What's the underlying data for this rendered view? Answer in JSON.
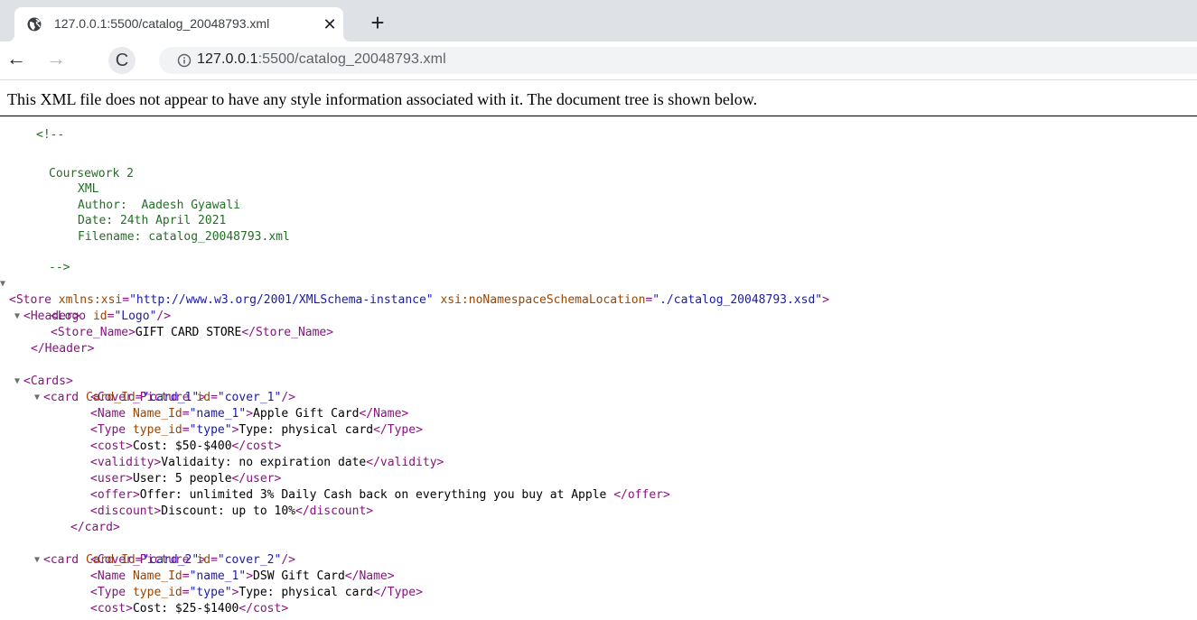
{
  "browser": {
    "tab": {
      "favicon": "globe-icon",
      "title": "127.0.0.1:5500/catalog_20048793.xml",
      "close_glyph": "✕"
    },
    "new_tab_glyph": "+",
    "nav": {
      "back_glyph": "←",
      "forward_glyph": "→",
      "reload_glyph": "C"
    },
    "address": {
      "icon": "info-icon",
      "host": "127.0.0.1",
      "rest": ":5500/catalog_20048793.xml"
    }
  },
  "notice": "This XML file does not appear to have any style information associated with it. The document tree is shown below.",
  "comment": {
    "open": "<!--",
    "lines": [
      "Coursework 2",
      "XML",
      "Author:  Aadesh Gyawali",
      "Date: 24th April 2021",
      "Filename: catalog_20048793.xml"
    ],
    "close": "-->"
  },
  "toggle_glyph": "▼",
  "store": {
    "open_tag": "<Store",
    "attr1_name": "xmlns:xsi",
    "attr1_value": "\"http://www.w3.org/2001/XMLSchema-instance\"",
    "attr2_name": "xsi:noNamespaceSchemaLocation",
    "attr2_value": "\"./catalog_20048793.xsd\"",
    "close_bracket": ">"
  },
  "header": {
    "open": "<Header>",
    "logo_tag": "<Logo",
    "logo_attr": "id",
    "logo_value": "\"Logo\"",
    "logo_end": "/>",
    "store_name_open": "<Store_Name>",
    "store_name_text": "GIFT CARD STORE",
    "store_name_close": "</Store_Name>",
    "close": "</Header>"
  },
  "cards_open": "<Cards>",
  "cards": [
    {
      "card_tag": "<card",
      "card_attr": "Card_Id",
      "card_value": "\"card_1\"",
      "cover_tag": "<Cover_Picture",
      "cover_attr": "id",
      "cover_value": "\"cover_1\"",
      "name_tag": "<Name",
      "name_attr": "Name_Id",
      "name_value": "\"name_1\"",
      "name_text": "Apple Gift Card",
      "name_close": "</Name>",
      "type_tag": "<Type",
      "type_attr": "type_id",
      "type_value": "\"type\"",
      "type_text": "Type: physical card",
      "type_close": "</Type>",
      "cost_open": "<cost>",
      "cost_text": "Cost: $50-$400",
      "cost_close": "</cost>",
      "validity_open": "<validity>",
      "validity_text": "Validaity: no expiration date",
      "validity_close": "</validity>",
      "user_open": "<user>",
      "user_text": "User: 5 people",
      "user_close": "</user>",
      "offer_open": "<offer>",
      "offer_text": "Offer: unlimited 3% Daily Cash back on everything you buy at Apple ",
      "offer_close": "</offer>",
      "discount_open": "<discount>",
      "discount_text": "Discount: up to 10%",
      "discount_close": "</discount>",
      "card_close": "</card>"
    },
    {
      "card_tag": "<card",
      "card_attr": "Card_Id",
      "card_value": "\"card_2\"",
      "cover_tag": "<Cover_Picture",
      "cover_attr": "id",
      "cover_value": "\"cover_2\"",
      "name_tag": "<Name",
      "name_attr": "Name_Id",
      "name_value": "\"name_1\"",
      "name_text": "DSW Gift Card",
      "name_close": "</Name>",
      "type_tag": "<Type",
      "type_attr": "type_id",
      "type_value": "\"type\"",
      "type_text": "Type: physical card",
      "type_close": "</Type>",
      "cost_open": "<cost>",
      "cost_text": "Cost: $25-$1400",
      "cost_close": "</cost>"
    }
  ],
  "colors": {
    "comment": "#236e25",
    "tag": "#881280",
    "attr_name": "#994500",
    "attr_value": "#1a1aa6"
  }
}
